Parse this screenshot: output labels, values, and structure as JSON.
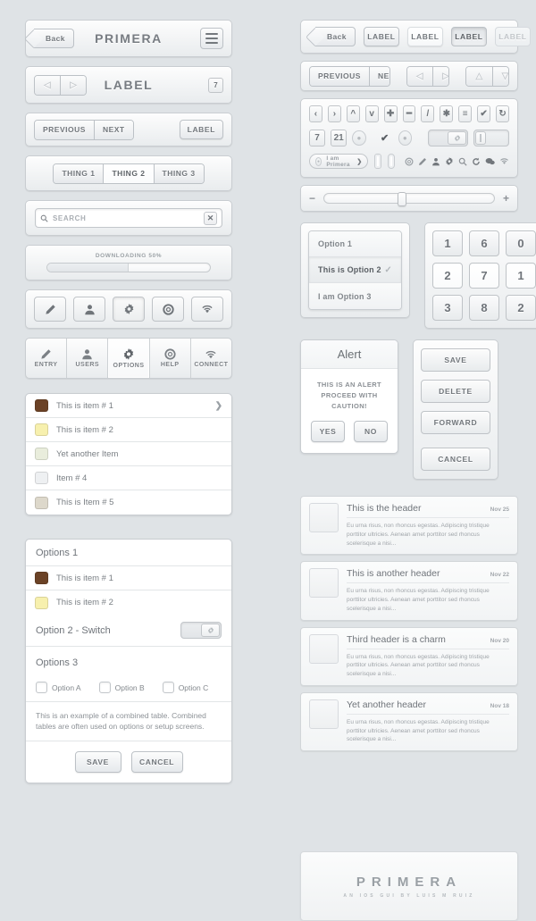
{
  "left": {
    "navbar": {
      "back_label": "Back",
      "title": "PRIMERA",
      "menu_icon": "hamburger-icon"
    },
    "labelbar": {
      "title": "LABEL",
      "badge": "7",
      "prev_icon": "triangle-left-icon",
      "next_icon": "triangle-right-icon"
    },
    "toolbar": {
      "previous": "PREVIOUS",
      "next": "NEXT",
      "label": "LABEL"
    },
    "segmented": {
      "items": [
        "THING 1",
        "THING 2",
        "THING 3"
      ],
      "selected_index": 1
    },
    "search": {
      "placeholder": "SEARCH",
      "icon": "search-icon",
      "clear_icon": "close-icon"
    },
    "progress": {
      "label": "DOWNLOADING 50%",
      "percent": 50
    },
    "icon_buttons": [
      {
        "icon": "pencil-icon",
        "active": false
      },
      {
        "icon": "person-icon",
        "active": false
      },
      {
        "icon": "gear-icon",
        "active": true
      },
      {
        "icon": "lifering-icon",
        "active": false
      },
      {
        "icon": "wifi-icon",
        "active": false
      }
    ],
    "tabbar": [
      {
        "label": "ENTRY",
        "icon": "pencil-icon",
        "active": false
      },
      {
        "label": "USERS",
        "icon": "person-icon",
        "active": false
      },
      {
        "label": "OPTIONS",
        "icon": "gear-icon",
        "active": true
      },
      {
        "label": "HELP",
        "icon": "lifering-icon",
        "active": false
      },
      {
        "label": "CONNECT",
        "icon": "wifi-icon",
        "active": false
      }
    ],
    "list": [
      {
        "label": "This is item # 1",
        "color": "#6b4226",
        "chevron": true
      },
      {
        "label": "This is item # 2",
        "color": "#f7f0ae",
        "chevron": false
      },
      {
        "label": "Yet another Item",
        "color": "#e9eddc",
        "chevron": false
      },
      {
        "label": "Item # 4",
        "color": "#eef0f2",
        "chevron": false
      },
      {
        "label": "This is Item # 5",
        "color": "#ddd8cb",
        "chevron": false
      }
    ],
    "combined": {
      "section1_title": "Options 1",
      "items": [
        {
          "label": "This is item # 1",
          "color": "#6b4226"
        },
        {
          "label": "This is item # 2",
          "color": "#f7f0ae"
        }
      ],
      "switch_label": "Option 2 - Switch",
      "switch_on": true,
      "section3_title": "Options 3",
      "checkboxes": [
        "Option A",
        "Option B",
        "Option C"
      ],
      "note": "This is an example of a combined table. Combined tables are often used on options or setup screens.",
      "save": "SAVE",
      "cancel": "CANCEL"
    }
  },
  "right": {
    "button_states": [
      {
        "label": "Back",
        "state": "back"
      },
      {
        "label": "LABEL",
        "state": "normal"
      },
      {
        "label": "LABEL",
        "state": "light"
      },
      {
        "label": "LABEL",
        "state": "pressed"
      },
      {
        "label": "LABEL",
        "state": "disabled"
      }
    ],
    "nav_buttons": {
      "previous": "PREVIOUS",
      "next": "NEXT"
    },
    "arrow_pads": [
      {
        "icons": [
          "triangle-left-icon",
          "triangle-right-icon"
        ]
      },
      {
        "icons": [
          "triangle-up-icon",
          "triangle-down-icon"
        ]
      }
    ],
    "icon_row_1": [
      "chevron-left-icon",
      "chevron-right-icon",
      "chevron-up-icon",
      "chevron-down-icon",
      "plus-icon",
      "minus-icon",
      "slash-icon",
      "asterisk-icon",
      "equals-icon",
      "check-icon",
      "refresh-icon"
    ],
    "badges": [
      "7",
      "21"
    ],
    "badge_icons": [
      "dot-badge-icon",
      "check-badge-icon",
      "dot-badge-icon"
    ],
    "pill": {
      "label": "I am Primera",
      "icon": "chevron-right-icon"
    },
    "checkboxes": [
      "checkbox-square-icon",
      "checkbox-rounded-icon"
    ],
    "toggles": [
      {
        "knob": "gear-icon",
        "on": true
      },
      {
        "knob": "bar-icon",
        "on": false
      }
    ],
    "mini_icons": [
      "lifering-icon",
      "pencil-icon",
      "person-icon",
      "gear-icon",
      "search-icon",
      "refresh-icon",
      "chat-icon",
      "wifi-icon"
    ],
    "slider": {
      "minus": "−",
      "plus": "+",
      "value_percent": 43
    },
    "options": [
      {
        "label": "Option 1",
        "selected": false
      },
      {
        "label": "This is Option 2",
        "selected": true
      },
      {
        "label": "I am Option 3",
        "selected": false
      }
    ],
    "keypad": [
      [
        "1",
        "6",
        "0"
      ],
      [
        "2",
        "7",
        "1"
      ],
      [
        "3",
        "8",
        "2"
      ]
    ],
    "keypad_active_row": 1,
    "alert": {
      "title": "Alert",
      "line1": "THIS IS AN ALERT",
      "line2": "PROCEED WITH CAUTION!",
      "yes": "YES",
      "no": "NO"
    },
    "stack_buttons": [
      "SAVE",
      "DELETE",
      "FORWARD",
      "CANCEL"
    ],
    "cards": [
      {
        "title": "This is the header",
        "date": "Nov 25",
        "body": "Eu urna risus, non rhoncus egestas. Adipiscing tristique porttitor ultricies. Aenean amet porttitor sed rhoncus scelerisque a nisi..."
      },
      {
        "title": "This is another header",
        "date": "Nov 22",
        "body": "Eu urna risus, non rhoncus egestas. Adipiscing tristique porttitor ultricies. Aenean amet porttitor sed rhoncus scelerisque a nisi..."
      },
      {
        "title": "Third header is a charm",
        "date": "Nov 20",
        "body": "Eu urna risus, non rhoncus egestas. Adipiscing tristique porttitor ultricies. Aenean amet porttitor sed rhoncus scelerisque a nisi..."
      },
      {
        "title": "Yet another header",
        "date": "Nov 18",
        "body": "Eu urna risus, non rhoncus egestas. Adipiscing tristique porttitor ultricies. Aenean amet porttitor sed rhoncus scelerisque a nisi..."
      }
    ],
    "logo": {
      "name": "PRIMERA",
      "tagline": "AN IOS GUI BY LUIS M RUIZ"
    }
  },
  "colors": {
    "background": "#dfe3e6",
    "panel": "#ffffff",
    "text": "#6e7378",
    "border": "#c9cdd1"
  }
}
